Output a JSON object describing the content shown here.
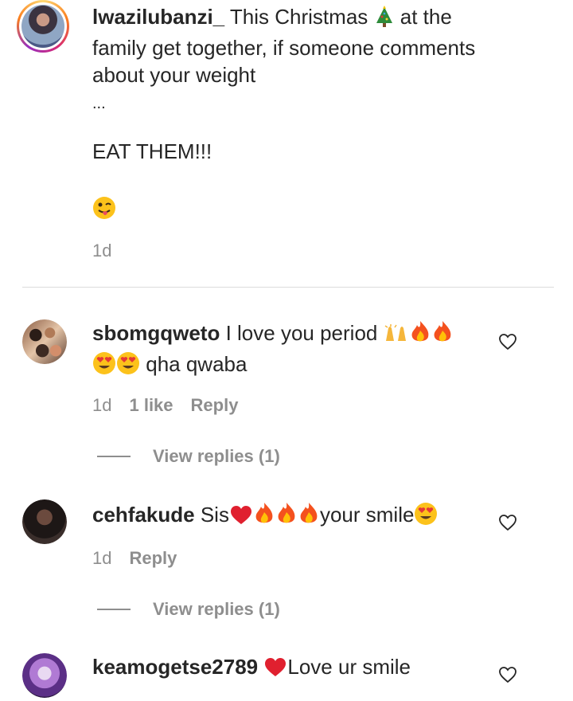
{
  "caption": {
    "username": "lwazilubanzi_",
    "line1_before": "This Christmas",
    "line1_after": "at the",
    "line2": "family get together, if someone comments",
    "line3": "about your weight",
    "ellipsis": "...",
    "line5": "EAT THEM!!!",
    "time": "1d"
  },
  "comments": [
    {
      "username": "sbomgqweto",
      "text_a": "I love you period",
      "text_b": "qha qwaba",
      "time": "1d",
      "likes": "1 like",
      "reply": "Reply",
      "view_replies": "View replies (1)"
    },
    {
      "username": "cehfakude",
      "text_a": "Sis",
      "text_b": "your smile",
      "time": "1d",
      "reply": "Reply",
      "view_replies": "View replies (1)"
    },
    {
      "username": "keamogetse2789",
      "text_a": "Love ur smile"
    }
  ]
}
